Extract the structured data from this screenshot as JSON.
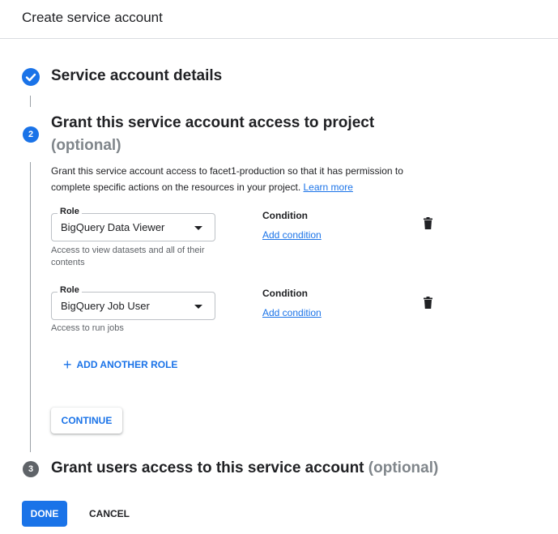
{
  "header": {
    "title": "Create service account"
  },
  "step1": {
    "title": "Service account details",
    "status": "complete"
  },
  "step2": {
    "number": "2",
    "title": "Grant this service account access to project",
    "optional": "(optional)",
    "description_line1": "Grant this service account access to facet1-production so that it has permission to",
    "description_line2": "complete specific actions on the resources in your project.",
    "learn_more": "Learn more",
    "roles": [
      {
        "legend": "Role",
        "value": "BigQuery Data Viewer",
        "hint_line1": "Access to view datasets and all of their",
        "hint_line2": "contents",
        "condition_label": "Condition",
        "add_condition": "Add condition"
      },
      {
        "legend": "Role",
        "value": "BigQuery Job User",
        "hint_line1": "Access to run jobs",
        "condition_label": "Condition",
        "add_condition": "Add condition"
      }
    ],
    "add_another_role": "ADD ANOTHER ROLE",
    "continue_label": "CONTINUE"
  },
  "step3": {
    "number": "3",
    "title": "Grant users access to this service account",
    "optional": "(optional)"
  },
  "footer": {
    "done_label": "DONE",
    "cancel_label": "CANCEL"
  },
  "colors": {
    "accent": "#1a73e8",
    "step_done": "#1a73e8",
    "step_active": "#1a73e8",
    "step_inactive": "#5f6368",
    "text": "#202124",
    "muted": "#80868b"
  }
}
